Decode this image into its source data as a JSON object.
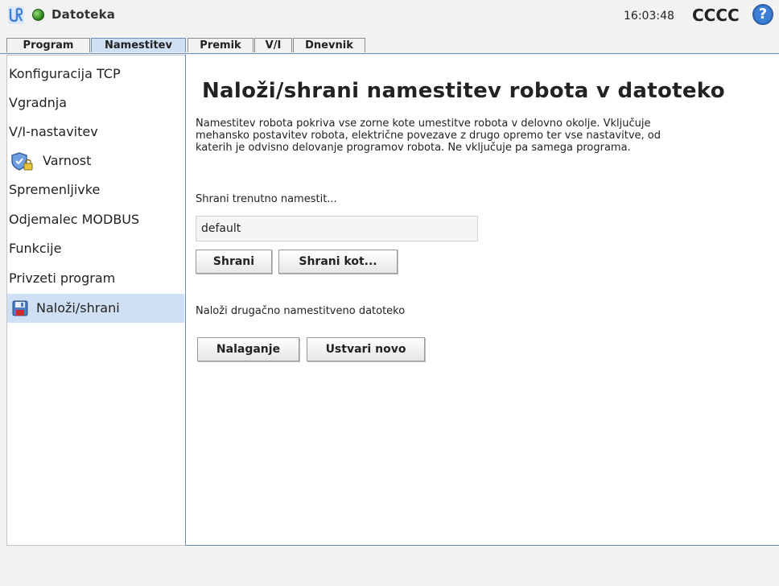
{
  "header": {
    "file_name": "Datoteka",
    "time": "16:03:48",
    "robot_name": "CCCC",
    "help_glyph": "?",
    "status_color": "#3a9a24"
  },
  "tabs": [
    {
      "label": "Program",
      "active": false
    },
    {
      "label": "Namestitev",
      "active": true
    },
    {
      "label": "Premik",
      "active": false
    },
    {
      "label": "V/I",
      "active": false
    },
    {
      "label": "Dnevnik",
      "active": false
    }
  ],
  "sidebar": {
    "items": [
      {
        "label": "Konfiguracija TCP",
        "icon": null
      },
      {
        "label": "Vgradnja",
        "icon": null
      },
      {
        "label": "V/I-nastavitev",
        "icon": null
      },
      {
        "label": "Varnost",
        "icon": "safety-shield-lock-icon"
      },
      {
        "label": "Spremenljivke",
        "icon": null
      },
      {
        "label": "Odjemalec MODBUS",
        "icon": null
      },
      {
        "label": "Funkcije",
        "icon": null
      },
      {
        "label": "Privzeti program",
        "icon": null
      },
      {
        "label": "Naloži/shrani",
        "icon": "floppy-disk-icon",
        "selected": true
      }
    ]
  },
  "main": {
    "title": "Naloži/shrani namestitev robota v datoteko",
    "description_lines": [
      "Namestitev robota pokriva vse zorne kote umestitve robota v delovno okolje. Vključuje",
      "mehansko postavitev robota, električne povezave z drugo opremo ter vse nastavitve, od",
      "katerih je odvisno delovanje programov robota. Ne vključuje pa samega programa."
    ],
    "save_label": "Shrani trenutno namestit...",
    "file_value": "default",
    "save_button": "Shrani",
    "save_as_button": "Shrani kot...",
    "load_label": "Naloži drugačno namestitveno datoteko",
    "load_button": "Nalaganje",
    "new_button": "Ustvari novo"
  },
  "colors": {
    "selection": "#cfe0f4",
    "accent_border": "#6b8fb7",
    "help_blue": "#3d7fd6"
  }
}
